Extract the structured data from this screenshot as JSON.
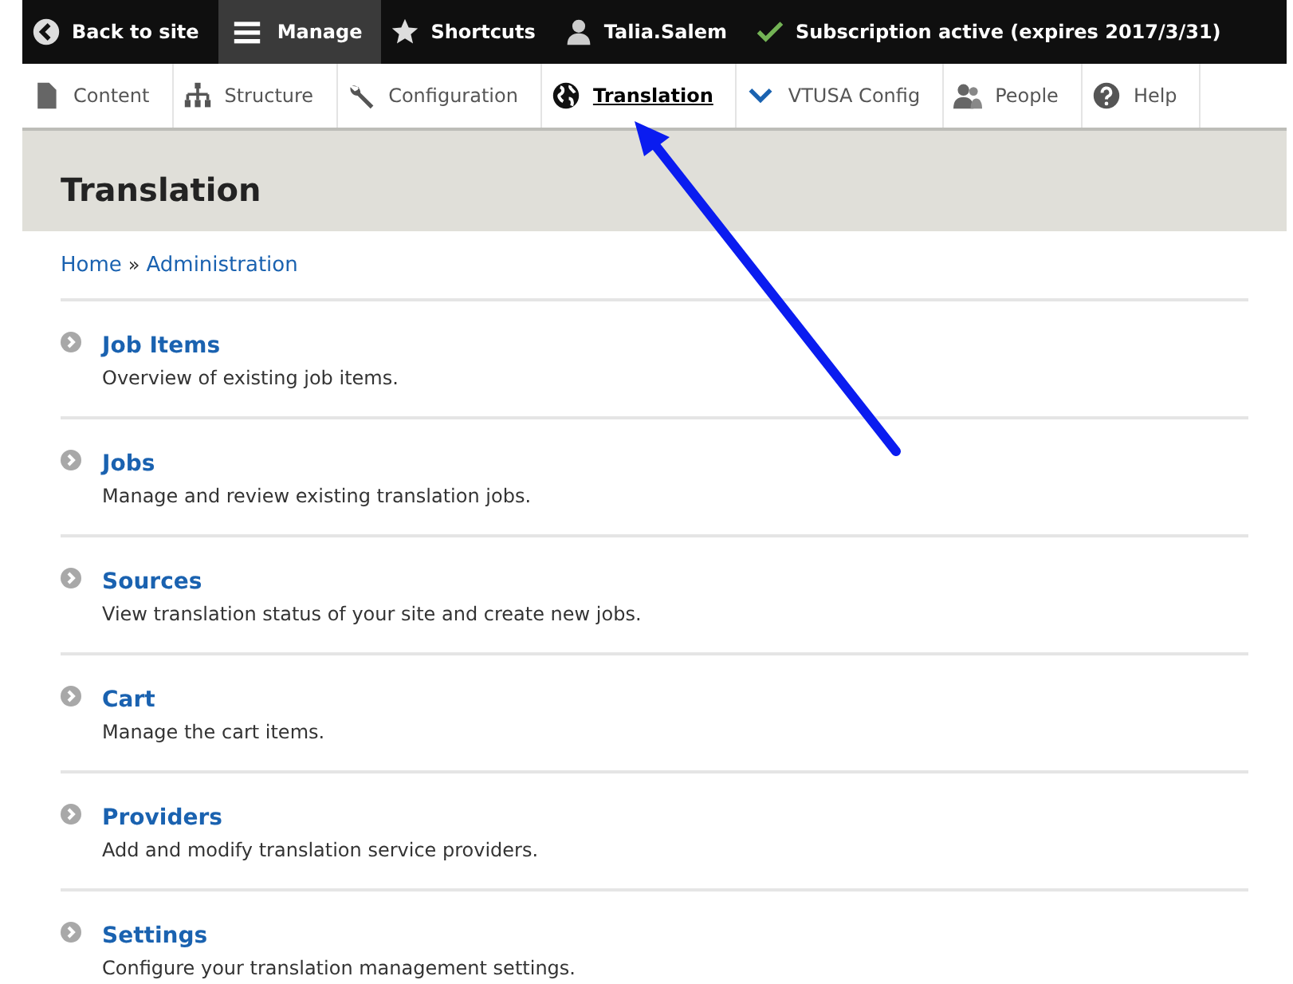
{
  "toolbar": [
    {
      "label": "Back to site",
      "kind": "back",
      "selected": false
    },
    {
      "label": "Manage",
      "kind": "menu",
      "selected": true
    },
    {
      "label": "Shortcuts",
      "kind": "star",
      "selected": false
    },
    {
      "label": "Talia.Salem",
      "kind": "user",
      "selected": false
    },
    {
      "label": "Subscription active (expires 2017/3/31)",
      "kind": "check",
      "selected": false
    }
  ],
  "tray": [
    {
      "label": "Content",
      "kind": "file",
      "selected": false
    },
    {
      "label": "Structure",
      "kind": "tree",
      "selected": false
    },
    {
      "label": "Configuration",
      "kind": "wrench",
      "selected": false
    },
    {
      "label": "Translation",
      "kind": "globe",
      "selected": true
    },
    {
      "label": "VTUSA Config",
      "kind": "chevron",
      "selected": false
    },
    {
      "label": "People",
      "kind": "people",
      "selected": false
    },
    {
      "label": "Help",
      "kind": "help",
      "selected": false
    }
  ],
  "page_title": "Translation",
  "breadcrumb": [
    "Home",
    "Administration"
  ],
  "breadcrumb_separator": "»",
  "items": [
    {
      "title": "Job Items",
      "description": "Overview of existing job items."
    },
    {
      "title": "Jobs",
      "description": "Manage and review existing translation jobs."
    },
    {
      "title": "Sources",
      "description": "View translation status of your site and create new jobs."
    },
    {
      "title": "Cart",
      "description": "Manage the cart items."
    },
    {
      "title": "Providers",
      "description": "Add and modify translation service providers."
    },
    {
      "title": "Settings",
      "description": "Configure your translation management settings."
    }
  ]
}
